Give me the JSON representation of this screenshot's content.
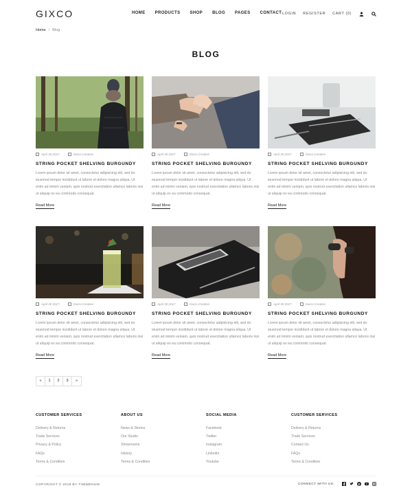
{
  "header": {
    "logo": "GIXCO",
    "nav": [
      "HOME",
      "PRODUCTS",
      "SHOP",
      "BLOG",
      "PAGES",
      "CONTACT"
    ],
    "login": "LOGIN",
    "register": "REGISTER",
    "cart": "CART (0)"
  },
  "breadcrumb": {
    "home": "Home",
    "current": "Blog"
  },
  "page_title": "BLOG",
  "posts": [
    {
      "date": "April 30 2017",
      "author": "Gixco Creative",
      "title": "STRING POCKET SHELVING BURGUNDY",
      "excerpt": "Lorem ipsum dolor sit amet, consectetur adipisicing elit, sed do eiusmod tempor incididunt ut labore et dolore magna aliqua. Ut enim ad minim veniam, quis nostrud exercitation ullamco laboris nisi ut aliquip ex ea commodo consequat.",
      "read_more": "Read More"
    },
    {
      "date": "April 30 2017",
      "author": "Gixco Creative",
      "title": "STRING POCKET SHELVING BURGUNDY",
      "excerpt": "Lorem ipsum dolor sit amet, consectetur adipisicing elit, sed do eiusmod tempor incididunt ut labore et dolore magna aliqua. Ut enim ad minim veniam, quis nostrud exercitation ullamco laboris nisi ut aliquip ex ea commodo consequat.",
      "read_more": "Read More"
    },
    {
      "date": "April 30 2017",
      "author": "Gixco Creative",
      "title": "STRING POCKET SHELVING BURGUNDY",
      "excerpt": "Lorem ipsum dolor sit amet, consectetur adipisicing elit, sed do eiusmod tempor incididunt ut labore et dolore magna aliqua. Ut enim ad minim veniam, quis nostrud exercitation ullamco laboris nisi ut aliquip ex ea commodo consequat.",
      "read_more": "Read More"
    },
    {
      "date": "April 30 2017",
      "author": "Gixco Creative",
      "title": "STRING POCKET SHELVING BURGUNDY",
      "excerpt": "Lorem ipsum dolor sit amet, consectetur adipisicing elit, sed do eiusmod tempor incididunt ut labore et dolore magna aliqua. Ut enim ad minim veniam, quis nostrud exercitation ullamco laboris nisi ut aliquip ex ea commodo consequat.",
      "read_more": "Read More"
    },
    {
      "date": "April 30 2017",
      "author": "Gixco Creative",
      "title": "STRING POCKET SHELVING BURGUNDY",
      "excerpt": "Lorem ipsum dolor sit amet, consectetur adipisicing elit, sed do eiusmod tempor incididunt ut labore et dolore magna aliqua. Ut enim ad minim veniam, quis nostrud exercitation ullamco laboris nisi ut aliquip ex ea commodo consequat.",
      "read_more": "Read More"
    },
    {
      "date": "April 30 2017",
      "author": "Gixco Creative",
      "title": "STRING POCKET SHELVING BURGUNDY",
      "excerpt": "Lorem ipsum dolor sit amet, consectetur adipisicing elit, sed do eiusmod tempor incididunt ut labore et dolore magna aliqua. Ut enim ad minim veniam, quis nostrud exercitation ullamco laboris nisi ut aliquip ex ea commodo consequat.",
      "read_more": "Read More"
    }
  ],
  "pagination": [
    "«",
    "1",
    "2",
    "3",
    "»"
  ],
  "footer": {
    "columns": [
      {
        "title": "CUSTOMER SERVICES",
        "links": [
          "Delivery & Returns",
          "Trade Services",
          "Privacy & Policy",
          "FAQs",
          "Terms & Condition"
        ]
      },
      {
        "title": "ABOUT US",
        "links": [
          "News & Stories",
          "Our Studio",
          "Showrooms",
          "History",
          "Terms & Condition"
        ]
      },
      {
        "title": "SOCIAL MEDIA",
        "links": [
          "Facebook",
          "Twitter",
          "Instagram",
          "Linkedin",
          "Youtube"
        ]
      },
      {
        "title": "CUSTOMER SERVICES",
        "links": [
          "Delivery & Returns",
          "Trade Services",
          "Contact Us",
          "FAQs",
          "Terms & Condition"
        ]
      }
    ],
    "copyright": "COPYRIGHT © 2019 BY THEMEHUM",
    "connect": "CONNECT WITH US:",
    "social_icons": [
      "facebook-icon",
      "twitter-icon",
      "pinterest-icon",
      "youtube-icon",
      "instagram-icon"
    ]
  }
}
